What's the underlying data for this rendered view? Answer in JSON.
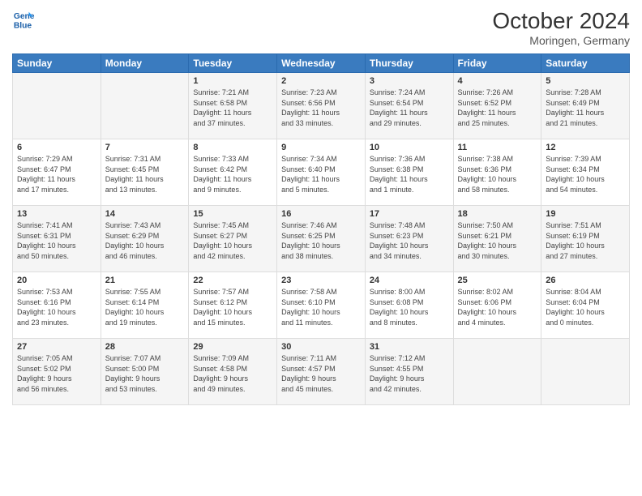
{
  "header": {
    "logo_line1": "General",
    "logo_line2": "Blue",
    "month": "October 2024",
    "location": "Moringen, Germany"
  },
  "weekdays": [
    "Sunday",
    "Monday",
    "Tuesday",
    "Wednesday",
    "Thursday",
    "Friday",
    "Saturday"
  ],
  "weeks": [
    [
      {
        "day": "",
        "info": ""
      },
      {
        "day": "",
        "info": ""
      },
      {
        "day": "1",
        "info": "Sunrise: 7:21 AM\nSunset: 6:58 PM\nDaylight: 11 hours\nand 37 minutes."
      },
      {
        "day": "2",
        "info": "Sunrise: 7:23 AM\nSunset: 6:56 PM\nDaylight: 11 hours\nand 33 minutes."
      },
      {
        "day": "3",
        "info": "Sunrise: 7:24 AM\nSunset: 6:54 PM\nDaylight: 11 hours\nand 29 minutes."
      },
      {
        "day": "4",
        "info": "Sunrise: 7:26 AM\nSunset: 6:52 PM\nDaylight: 11 hours\nand 25 minutes."
      },
      {
        "day": "5",
        "info": "Sunrise: 7:28 AM\nSunset: 6:49 PM\nDaylight: 11 hours\nand 21 minutes."
      }
    ],
    [
      {
        "day": "6",
        "info": "Sunrise: 7:29 AM\nSunset: 6:47 PM\nDaylight: 11 hours\nand 17 minutes."
      },
      {
        "day": "7",
        "info": "Sunrise: 7:31 AM\nSunset: 6:45 PM\nDaylight: 11 hours\nand 13 minutes."
      },
      {
        "day": "8",
        "info": "Sunrise: 7:33 AM\nSunset: 6:42 PM\nDaylight: 11 hours\nand 9 minutes."
      },
      {
        "day": "9",
        "info": "Sunrise: 7:34 AM\nSunset: 6:40 PM\nDaylight: 11 hours\nand 5 minutes."
      },
      {
        "day": "10",
        "info": "Sunrise: 7:36 AM\nSunset: 6:38 PM\nDaylight: 11 hours\nand 1 minute."
      },
      {
        "day": "11",
        "info": "Sunrise: 7:38 AM\nSunset: 6:36 PM\nDaylight: 10 hours\nand 58 minutes."
      },
      {
        "day": "12",
        "info": "Sunrise: 7:39 AM\nSunset: 6:34 PM\nDaylight: 10 hours\nand 54 minutes."
      }
    ],
    [
      {
        "day": "13",
        "info": "Sunrise: 7:41 AM\nSunset: 6:31 PM\nDaylight: 10 hours\nand 50 minutes."
      },
      {
        "day": "14",
        "info": "Sunrise: 7:43 AM\nSunset: 6:29 PM\nDaylight: 10 hours\nand 46 minutes."
      },
      {
        "day": "15",
        "info": "Sunrise: 7:45 AM\nSunset: 6:27 PM\nDaylight: 10 hours\nand 42 minutes."
      },
      {
        "day": "16",
        "info": "Sunrise: 7:46 AM\nSunset: 6:25 PM\nDaylight: 10 hours\nand 38 minutes."
      },
      {
        "day": "17",
        "info": "Sunrise: 7:48 AM\nSunset: 6:23 PM\nDaylight: 10 hours\nand 34 minutes."
      },
      {
        "day": "18",
        "info": "Sunrise: 7:50 AM\nSunset: 6:21 PM\nDaylight: 10 hours\nand 30 minutes."
      },
      {
        "day": "19",
        "info": "Sunrise: 7:51 AM\nSunset: 6:19 PM\nDaylight: 10 hours\nand 27 minutes."
      }
    ],
    [
      {
        "day": "20",
        "info": "Sunrise: 7:53 AM\nSunset: 6:16 PM\nDaylight: 10 hours\nand 23 minutes."
      },
      {
        "day": "21",
        "info": "Sunrise: 7:55 AM\nSunset: 6:14 PM\nDaylight: 10 hours\nand 19 minutes."
      },
      {
        "day": "22",
        "info": "Sunrise: 7:57 AM\nSunset: 6:12 PM\nDaylight: 10 hours\nand 15 minutes."
      },
      {
        "day": "23",
        "info": "Sunrise: 7:58 AM\nSunset: 6:10 PM\nDaylight: 10 hours\nand 11 minutes."
      },
      {
        "day": "24",
        "info": "Sunrise: 8:00 AM\nSunset: 6:08 PM\nDaylight: 10 hours\nand 8 minutes."
      },
      {
        "day": "25",
        "info": "Sunrise: 8:02 AM\nSunset: 6:06 PM\nDaylight: 10 hours\nand 4 minutes."
      },
      {
        "day": "26",
        "info": "Sunrise: 8:04 AM\nSunset: 6:04 PM\nDaylight: 10 hours\nand 0 minutes."
      }
    ],
    [
      {
        "day": "27",
        "info": "Sunrise: 7:05 AM\nSunset: 5:02 PM\nDaylight: 9 hours\nand 56 minutes."
      },
      {
        "day": "28",
        "info": "Sunrise: 7:07 AM\nSunset: 5:00 PM\nDaylight: 9 hours\nand 53 minutes."
      },
      {
        "day": "29",
        "info": "Sunrise: 7:09 AM\nSunset: 4:58 PM\nDaylight: 9 hours\nand 49 minutes."
      },
      {
        "day": "30",
        "info": "Sunrise: 7:11 AM\nSunset: 4:57 PM\nDaylight: 9 hours\nand 45 minutes."
      },
      {
        "day": "31",
        "info": "Sunrise: 7:12 AM\nSunset: 4:55 PM\nDaylight: 9 hours\nand 42 minutes."
      },
      {
        "day": "",
        "info": ""
      },
      {
        "day": "",
        "info": ""
      }
    ]
  ]
}
